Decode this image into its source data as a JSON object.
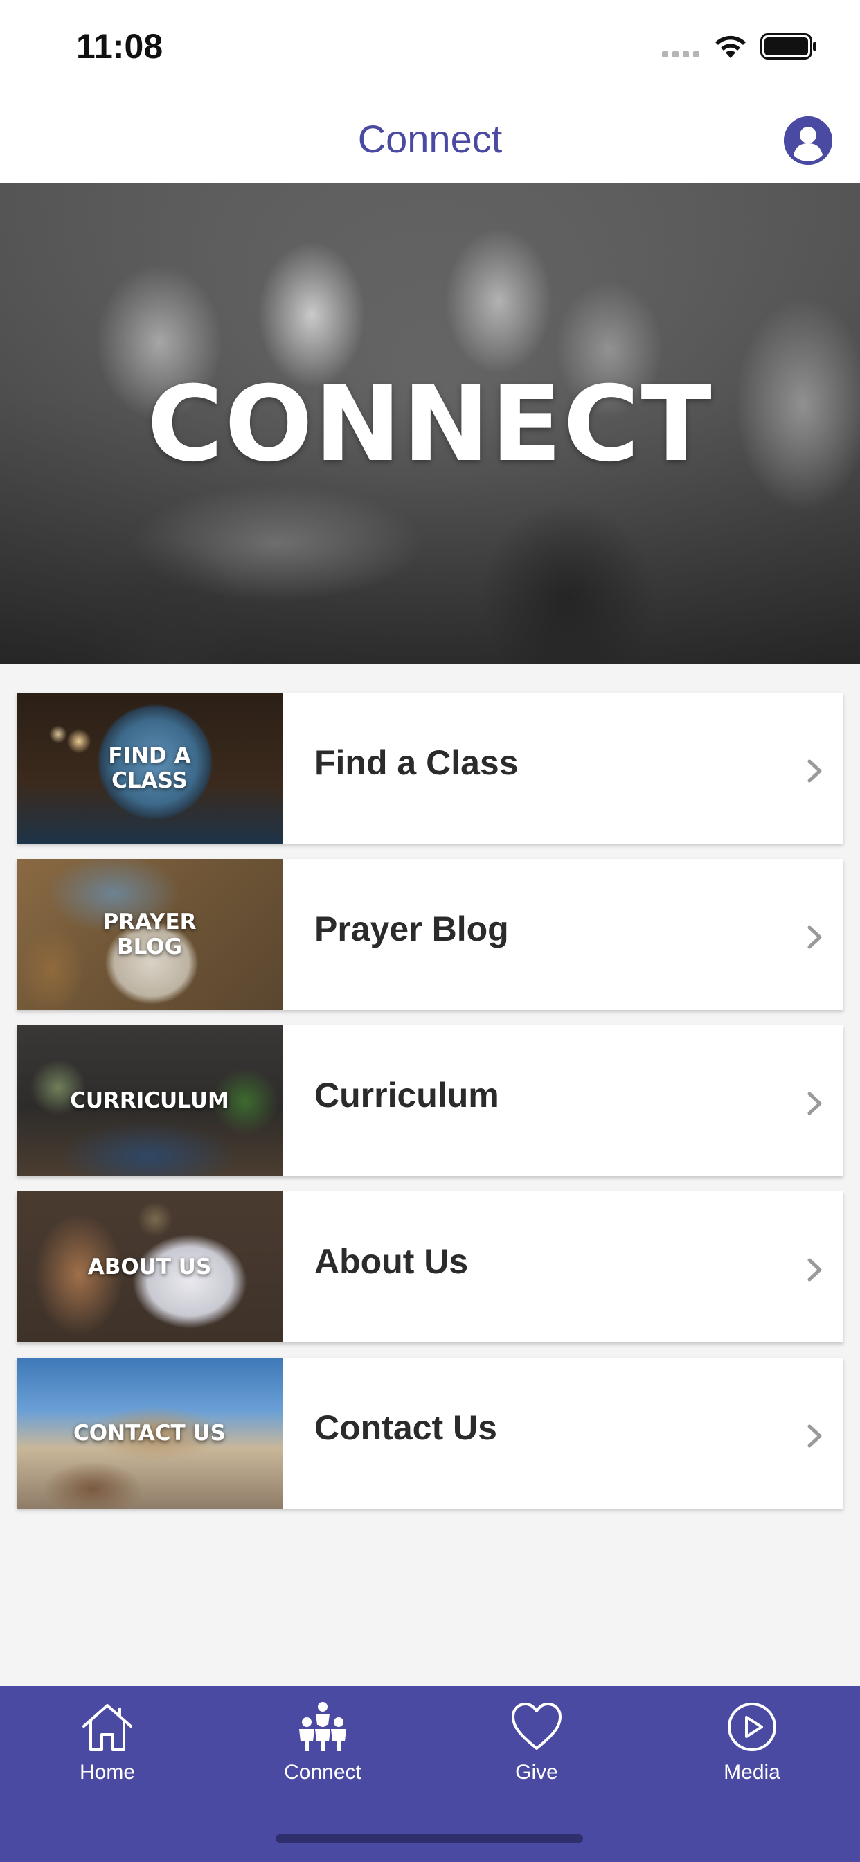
{
  "status_bar": {
    "time": "11:08"
  },
  "nav": {
    "title": "Connect",
    "profile_icon": "person-circle-icon"
  },
  "hero": {
    "title": "CONNECT"
  },
  "menu": [
    {
      "thumb_label": "FIND A\nCLASS",
      "label": "Find a Class"
    },
    {
      "thumb_label": "PRAYER\nBLOG",
      "label": "Prayer Blog"
    },
    {
      "thumb_label": "CURRICULUM",
      "label": "Curriculum"
    },
    {
      "thumb_label": "ABOUT US",
      "label": "About Us"
    },
    {
      "thumb_label": "CONTACT US",
      "label": "Contact Us"
    }
  ],
  "tabs": [
    {
      "label": "Home",
      "icon": "home-icon"
    },
    {
      "label": "Connect",
      "icon": "people-icon"
    },
    {
      "label": "Give",
      "icon": "heart-icon"
    },
    {
      "label": "Media",
      "icon": "play-circle-icon"
    }
  ],
  "colors": {
    "accent": "#4a4aa3",
    "tab_bar": "#4a4aa3",
    "background": "#f4f4f4",
    "row_text": "#2b2b2b"
  }
}
